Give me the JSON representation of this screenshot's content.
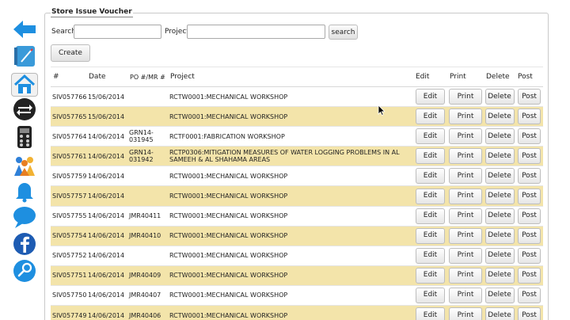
{
  "panel": {
    "title": "Store Issue Voucher"
  },
  "search": {
    "label": "Search",
    "value": "",
    "project_label": "Project",
    "project_value": "",
    "button": "search"
  },
  "create_button": "Create",
  "columns": [
    "#",
    "Date",
    "PO #/MR #",
    "Project",
    "Edit",
    "Print",
    "Delete",
    "Post"
  ],
  "actions": {
    "edit": "Edit",
    "print": "Print",
    "delete": "Delete",
    "post": "Post"
  },
  "rows": [
    {
      "id": "SIV057766",
      "date": "15/06/2014",
      "po": "",
      "project": "RCTW0001:MECHANICAL WORKSHOP"
    },
    {
      "id": "SIV057765",
      "date": "15/06/2014",
      "po": "",
      "project": "RCTW0001:MECHANICAL WORKSHOP"
    },
    {
      "id": "SIV057764",
      "date": "14/06/2014",
      "po": "GRN14-031945",
      "project": "RCTF0001:FABRICATION WORKSHOP"
    },
    {
      "id": "SIV057761",
      "date": "14/06/2014",
      "po": "GRN14-031942",
      "project": "RCTP0306:MITIGATION MEASURES OF WATER LOGGING PROBLEMS IN AL SAMEEH & AL SHAHAMA AREAS"
    },
    {
      "id": "SIV057759",
      "date": "14/06/2014",
      "po": "",
      "project": "RCTW0001:MECHANICAL WORKSHOP"
    },
    {
      "id": "SIV057757",
      "date": "14/06/2014",
      "po": "",
      "project": "RCTW0001:MECHANICAL WORKSHOP"
    },
    {
      "id": "SIV057755",
      "date": "14/06/2014",
      "po": "JMR40411",
      "project": "RCTW0001:MECHANICAL WORKSHOP"
    },
    {
      "id": "SIV057754",
      "date": "14/06/2014",
      "po": "JMR40410",
      "project": "RCTW0001:MECHANICAL WORKSHOP"
    },
    {
      "id": "SIV057752",
      "date": "14/06/2014",
      "po": "",
      "project": "RCTW0001:MECHANICAL WORKSHOP"
    },
    {
      "id": "SIV057751",
      "date": "14/06/2014",
      "po": "JMR40409",
      "project": "RCTW0001:MECHANICAL WORKSHOP"
    },
    {
      "id": "SIV057750",
      "date": "14/06/2014",
      "po": "JMR40407",
      "project": "RCTW0001:MECHANICAL WORKSHOP"
    },
    {
      "id": "SIV057749",
      "date": "14/06/2014",
      "po": "JMR40406",
      "project": "RCTW0001:MECHANICAL WORKSHOP"
    }
  ],
  "dock_icons": [
    "back-arrow-icon",
    "notebook-icon",
    "home-icon",
    "swap-icon",
    "calculator-icon",
    "people-icon",
    "bell-icon",
    "chat-bubble-icon",
    "facebook-icon",
    "search-magnifier-icon"
  ],
  "colors": {
    "row_alt": "#f3e4aa",
    "dock_blue": "#1e8fe0",
    "dock_dark": "#222222"
  }
}
